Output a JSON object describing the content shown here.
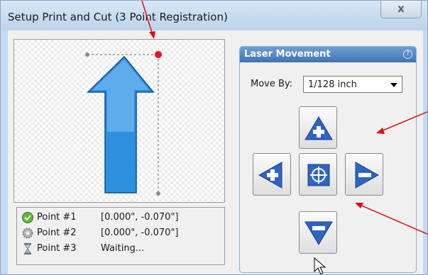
{
  "window": {
    "title": "Setup Print and Cut (3 Point Registration)",
    "close_glyph": "x"
  },
  "points": [
    {
      "icon": "check-icon",
      "label": "Point #1",
      "value": "[0.000\", -0.070\"]"
    },
    {
      "icon": "gear-icon",
      "label": "Point #2",
      "value": "[0.000\", -0.070\"]"
    },
    {
      "icon": "hourglass-icon",
      "label": "Point #3",
      "value": "Waiting..."
    }
  ],
  "laser": {
    "title": "Laser Movement",
    "help_glyph": "?",
    "move_by_label": "Move By:",
    "move_by_value": "1/128 inch"
  },
  "colors": {
    "arrow_blue": "#2f8fe0",
    "button_blue": "#2e64c4",
    "registration_point": "#e8141c",
    "annotation_arrow": "#e01010"
  }
}
